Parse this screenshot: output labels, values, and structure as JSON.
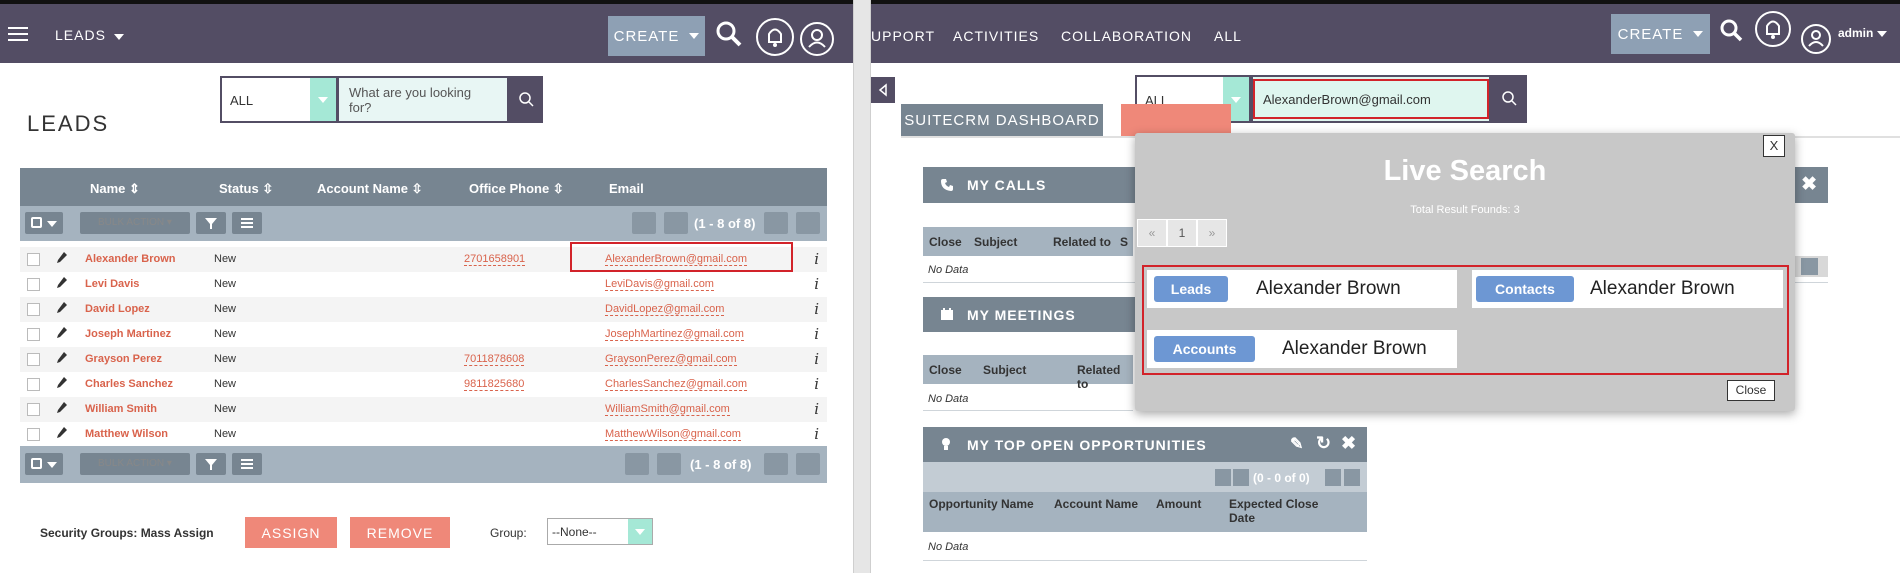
{
  "left": {
    "nav": {
      "module": "LEADS",
      "create": "CREATE"
    },
    "search": {
      "filter": "ALL",
      "placeholder": "What are you looking for?"
    },
    "page_title": "LEADS",
    "table": {
      "headers": [
        "Name",
        "Status",
        "Account Name",
        "Office Phone",
        "Email"
      ],
      "bulk_action": "BULK ACTION",
      "pagination": "(1 - 8 of 8)",
      "rows": [
        {
          "name": "Alexander Brown",
          "status": "New",
          "phone": "2701658901",
          "email": "AlexanderBrown@gmail.com"
        },
        {
          "name": "Levi Davis",
          "status": "New",
          "phone": "",
          "email": "LeviDavis@gmail.com"
        },
        {
          "name": "David Lopez",
          "status": "New",
          "phone": "",
          "email": "DavidLopez@gmail.com"
        },
        {
          "name": "Joseph Martinez",
          "status": "New",
          "phone": "",
          "email": "JosephMartinez@gmail.com"
        },
        {
          "name": "Grayson Perez",
          "status": "New",
          "phone": "7011878608",
          "email": "GraysonPerez@gmail.com"
        },
        {
          "name": "Charles Sanchez",
          "status": "New",
          "phone": "9811825680",
          "email": "CharlesSanchez@gmail.com"
        },
        {
          "name": "William Smith",
          "status": "New",
          "phone": "",
          "email": "WilliamSmith@gmail.com"
        },
        {
          "name": "Matthew Wilson",
          "status": "New",
          "phone": "",
          "email": "MatthewWilson@gmail.com"
        }
      ],
      "info_glyph": "i"
    },
    "mass_assign": {
      "label": "Security Groups: Mass Assign",
      "assign": "ASSIGN",
      "remove": "REMOVE",
      "group_label": "Group:",
      "group_value": "--None--"
    }
  },
  "right": {
    "nav": {
      "items": [
        "UPPORT",
        "ACTIVITIES",
        "COLLABORATION",
        "ALL"
      ],
      "create": "CREATE",
      "user": "admin"
    },
    "search": {
      "filter": "ALL",
      "value": "AlexanderBrown@gmail.com"
    },
    "tabs": {
      "dashboard": "SUITECRM DASHBOARD"
    },
    "calls": {
      "title": "MY CALLS",
      "cols": [
        "Close",
        "Subject",
        "Related to",
        "S"
      ],
      "nodata": "No Data"
    },
    "meetings": {
      "title": "MY MEETINGS",
      "cols": [
        "Close",
        "Subject",
        "Related to"
      ],
      "nodata": "No Data"
    },
    "opps": {
      "title": "MY TOP OPEN OPPORTUNITIES",
      "pagination": "(0 - 0 of 0)",
      "cols": [
        "Opportunity Name",
        "Account Name",
        "Amount",
        "Expected Close Date"
      ],
      "nodata": "No Data"
    },
    "live_search": {
      "title": "Live Search",
      "subtitle": "Total Result Founds: 3",
      "pager": [
        "«",
        "1",
        "»"
      ],
      "close_x": "X",
      "close": "Close",
      "results": [
        {
          "module": "Leads",
          "name": "Alexander Brown"
        },
        {
          "module": "Contacts",
          "name": "Alexander Brown"
        },
        {
          "module": "Accounts",
          "name": "Alexander Brown"
        }
      ]
    }
  },
  "colors": {
    "nav": "#534d64",
    "accent_red": "#ef8879",
    "link": "#d9634c",
    "pill": "#6d97d3",
    "highlight": "#d2232a"
  }
}
